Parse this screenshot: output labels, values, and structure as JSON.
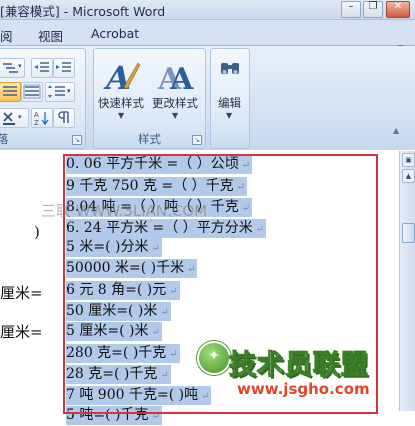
{
  "window": {
    "title": "[兼容模式] - Microsoft Word"
  },
  "tabs": [
    "阅",
    "视图",
    "Acrobat"
  ],
  "ribbon": {
    "styles_group": {
      "label": "样式",
      "quick_styles_label": "快速样式",
      "change_styles_label": "更改样式"
    },
    "editing_group": {
      "label": "编辑"
    },
    "paragraph_group_partial_label": "落"
  },
  "document": {
    "left_fragments": [
      ")",
      "厘米=",
      "厘米="
    ],
    "selected_lines": [
      "0. 06 平方千米 =（        ）公顷",
      "9 千克 750 克 =（        ）千克",
      "8.04 吨 =（        ）吨（        ）千克",
      "6. 24 平方米 =（        ）平方分米",
      "5 米=(        )分米",
      "50000 米=(        )千米",
      "6 元 8 角=(        )元",
      "50 厘米=(        )米",
      "5 厘米=(        )米",
      "280 克=(        )千克",
      "28 克=(        )千克",
      "7 吨 900 千克=(        )吨",
      "5 吨=(        )千克"
    ],
    "paragraph_mark": "↵"
  },
  "watermark": {
    "text": "三联 WWW.3LIAN.COM"
  },
  "logo": {
    "name": "技术员联盟",
    "url": "www.jsgho.com"
  }
}
